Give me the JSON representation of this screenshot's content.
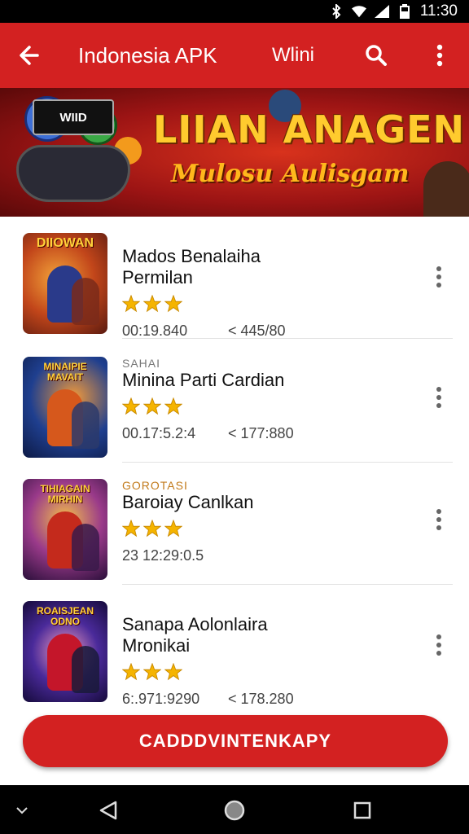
{
  "status_bar": {
    "time": "11:30",
    "icons": [
      "bluetooth-icon",
      "wifi-icon",
      "signal-icon",
      "battery-icon"
    ]
  },
  "app_bar": {
    "title": "Indonesia APK",
    "subtitle": "Wlini",
    "icons": [
      "back-arrow-icon",
      "search-icon",
      "more-vert-icon"
    ]
  },
  "banner": {
    "controller_text": "WIID",
    "headline": "LIIAN ANAGEN",
    "tagline": "Mulosu Aulisgam"
  },
  "apps": [
    {
      "thumb_label": "DIIOWAN",
      "prefix": "",
      "name_line1": "Mados Benalaiha",
      "name_line2": "Permilan",
      "rating": 3,
      "stat1": "00:19.840",
      "stat2": "< 445/80",
      "colors": {
        "bg": "#c2461a",
        "accent": "#2a3a8a"
      }
    },
    {
      "thumb_label": "MINAIPIE\nMAVAIT",
      "prefix": "SAHAI",
      "name_line1": "Minina Parti Cardian",
      "name_line2": "",
      "rating": 3,
      "stat1": "00.17:5.2:4",
      "stat2": "< 177:880",
      "colors": {
        "bg": "#1f3f8f",
        "accent": "#d6581c"
      }
    },
    {
      "thumb_label": "TIHIAGAIN\nMIRHIN",
      "prefix": "GOROTASI",
      "name_line1": "Baroiay Canlkan",
      "name_line2": "",
      "rating": 3,
      "stat1": "23 12:29:0.5",
      "stat2": "",
      "colors": {
        "bg": "#6a2a8a",
        "accent": "#c42a1c"
      }
    },
    {
      "thumb_label": "ROAISJEAN\nODNO",
      "prefix": "",
      "name_line1": "Sanapa Aolonlaira",
      "name_line2": "Mronikai",
      "rating": 3,
      "stat1": "6:.971:9290",
      "stat2": "< 178.280",
      "colors": {
        "bg": "#2a1f7a",
        "accent": "#c4162a"
      }
    }
  ],
  "cta": {
    "label": "CADDDVINTENKAPY"
  },
  "nav_bar": {
    "icons": [
      "keyboard-hide-icon",
      "back-triangle-icon",
      "home-circle-icon",
      "recents-square-icon"
    ]
  },
  "colors": {
    "primary": "#d32121",
    "star": "#f5b400",
    "text": "#111111"
  }
}
